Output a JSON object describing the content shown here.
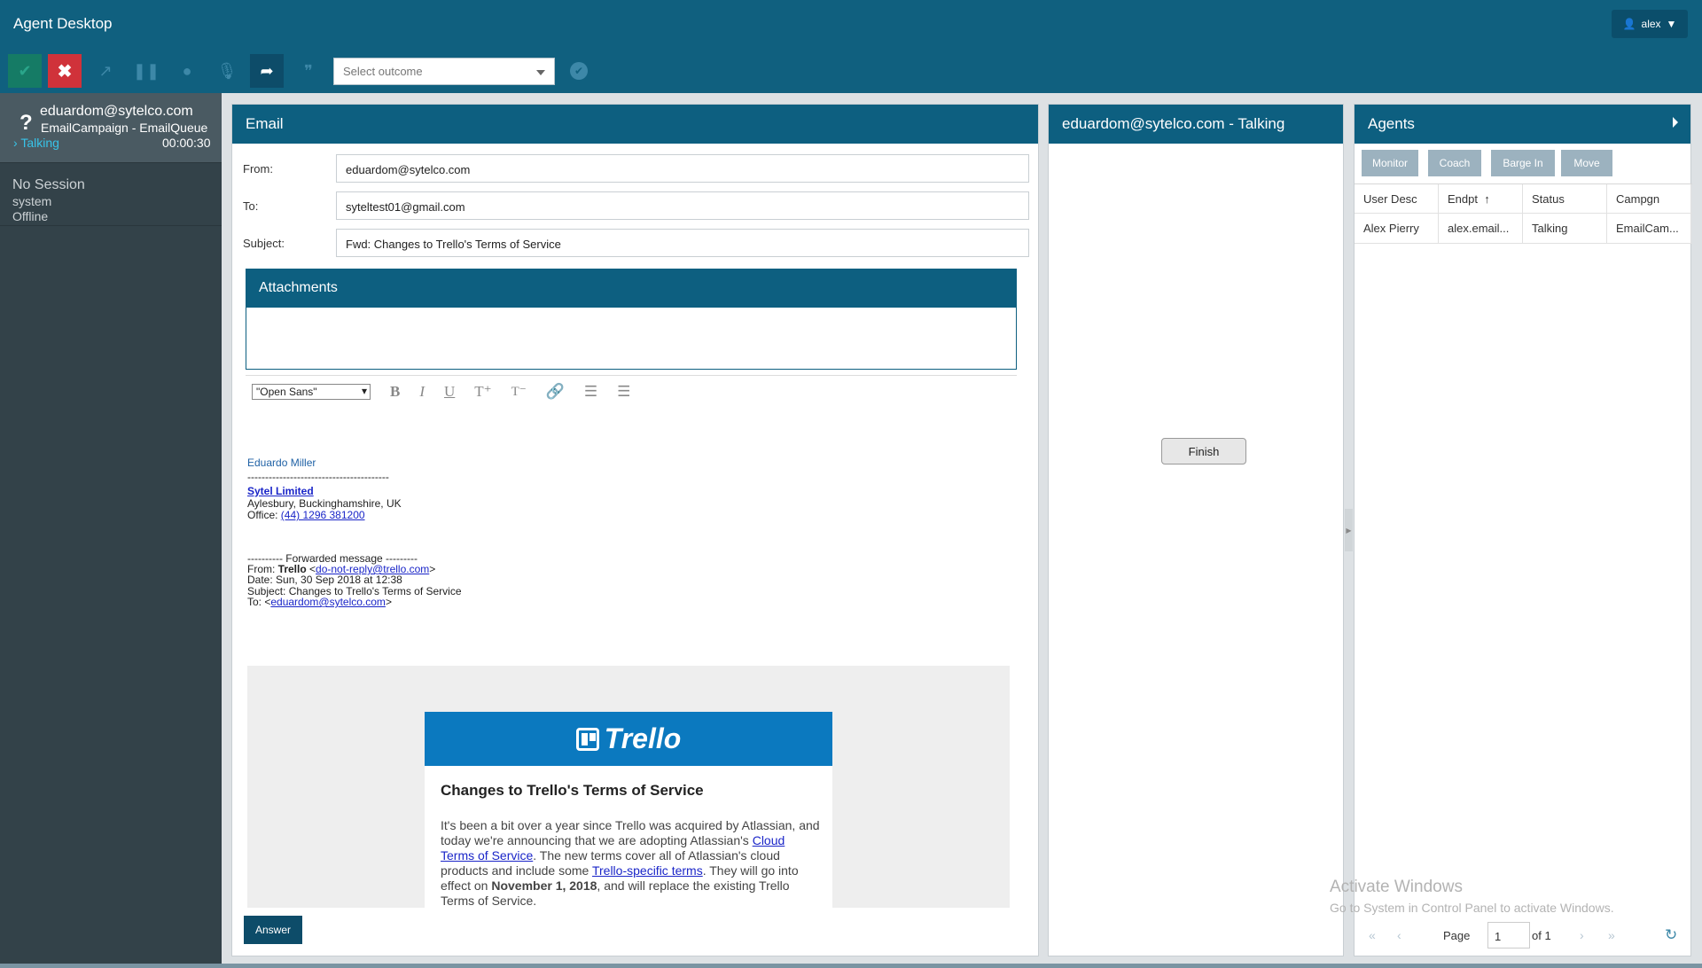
{
  "app": {
    "title": "Agent Desktop",
    "user": "alex"
  },
  "toolbar": {
    "outcome_placeholder": "Select outcome"
  },
  "sessions": [
    {
      "email": "eduardom@sytelco.com",
      "queue": "EmailCampaign - EmailQueue",
      "status": "Talking",
      "time": "00:00:30"
    },
    {
      "title": "No Session",
      "sub": "system",
      "status": "Offline"
    }
  ],
  "email": {
    "panel_title": "Email",
    "from_label": "From:",
    "from": "eduardom@sytelco.com",
    "to_label": "To:",
    "to": "syteltest01@gmail.com",
    "subject_label": "Subject:",
    "subject": "Fwd: Changes to Trello's Terms of Service",
    "attachments_title": "Attachments",
    "font_select": "\"Open Sans\"",
    "body": {
      "signature_name": "Eduardo Miller",
      "separator": "----------------------------------------",
      "company": "Sytel Limited",
      "address": "Aylesbury, Buckinghamshire, UK",
      "office_label": "Office: ",
      "office_phone": "(44) 1296 381200",
      "fwd_header": "---------- Forwarded message ---------",
      "fwd_from_label": "From: ",
      "fwd_from_name": "Trello",
      "fwd_from_email": "do-not-reply@trello.com",
      "fwd_date": "Date: Sun, 30 Sep 2018 at 12:38",
      "fwd_subject": "Subject: Changes to Trello's Terms of Service",
      "fwd_to_label": "To: ",
      "fwd_to_email": "eduardom@sytelco.com",
      "trello_logo": "Trello",
      "trello_title": "Changes to Trello's Terms of Service",
      "trello_p1": "It's been a bit over a year since Trello was acquired by Atlassian, and today we're announcing that we are adopting Atlassian's ",
      "trello_link1": "Cloud Terms of Service",
      "trello_p2": ". The new terms cover all of Atlassian's cloud products and include some ",
      "trello_link2": "Trello-specific terms",
      "trello_p3": ". They will go into effect on ",
      "trello_date": "November 1, 2018",
      "trello_p4": ", and will replace the existing Trello Terms of Service."
    },
    "answer_label": "Answer"
  },
  "call": {
    "title": "eduardom@sytelco.com - Talking",
    "finish_label": "Finish"
  },
  "agents": {
    "title": "Agents",
    "buttons": [
      "Monitor",
      "Coach",
      "Barge In",
      "Move"
    ],
    "columns": [
      "User Desc",
      "Endpt",
      "Status",
      "Campgn"
    ],
    "rows": [
      [
        "Alex Pierry",
        "alex.email...",
        "Talking",
        "EmailCam..."
      ]
    ],
    "page_label": "Page",
    "page": "1",
    "of_label": "of 1"
  },
  "watermark": {
    "line1": "Activate Windows",
    "line2": "Go to System in Control Panel to activate Windows."
  }
}
